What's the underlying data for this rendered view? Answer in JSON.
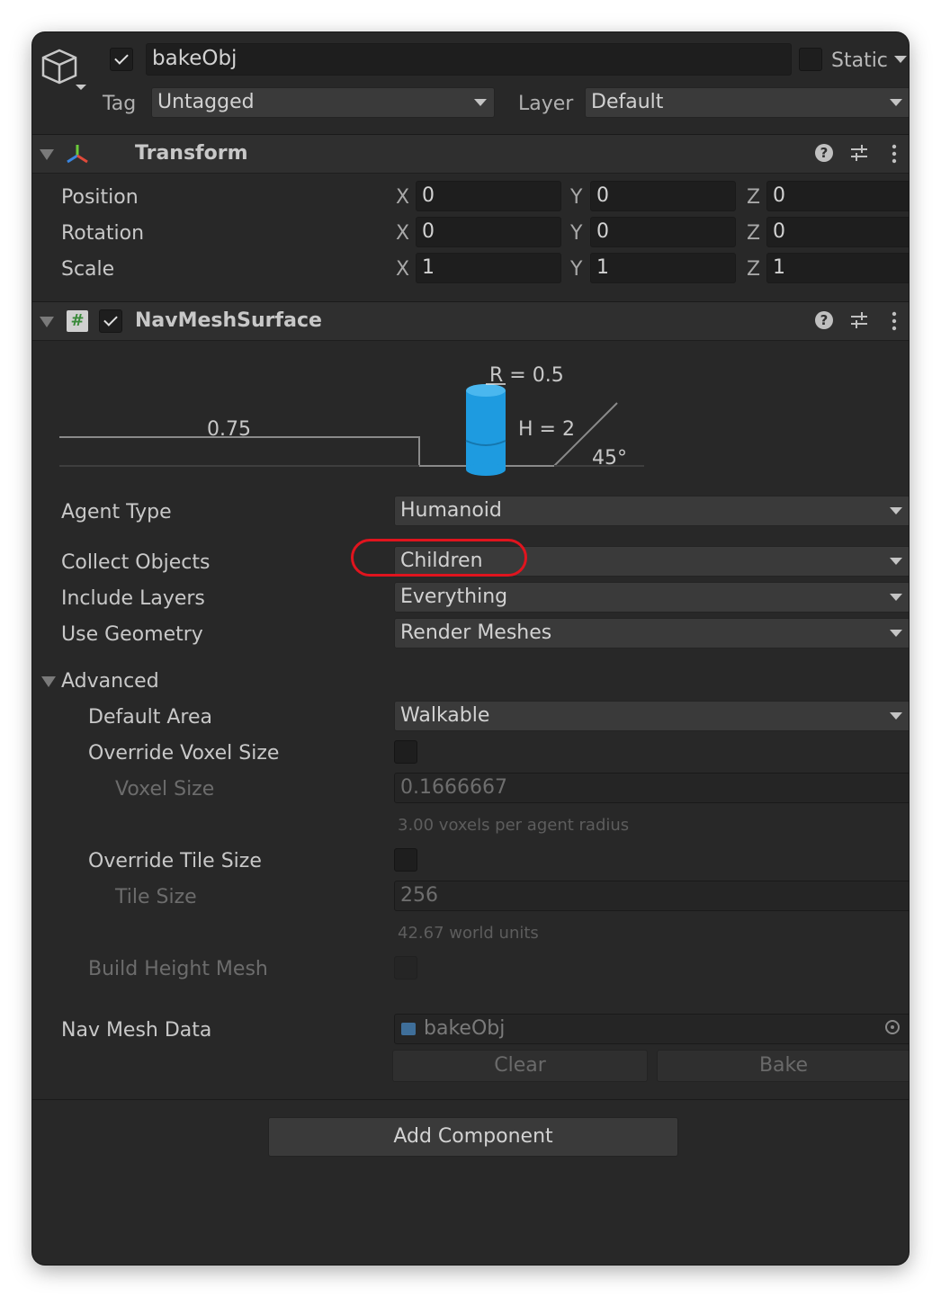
{
  "header": {
    "object_name": "bakeObj",
    "active": true,
    "static_label": "Static",
    "tag_label": "Tag",
    "tag_value": "Untagged",
    "layer_label": "Layer",
    "layer_value": "Default"
  },
  "transform": {
    "title": "Transform",
    "rows": [
      {
        "label": "Position",
        "x": "0",
        "y": "0",
        "z": "0"
      },
      {
        "label": "Rotation",
        "x": "0",
        "y": "0",
        "z": "0"
      },
      {
        "label": "Scale",
        "x": "1",
        "y": "1",
        "z": "1"
      }
    ],
    "axis_x": "X",
    "axis_y": "Y",
    "axis_z": "Z"
  },
  "navmesh": {
    "title": "NavMeshSurface",
    "enabled": true,
    "diagram": {
      "radius": "R = 0.5",
      "height": "H = 2",
      "step": "0.75",
      "slope": "45°"
    },
    "agent_type": {
      "label": "Agent Type",
      "value": "Humanoid"
    },
    "collect_objects": {
      "label": "Collect Objects",
      "value": "Children",
      "highlighted": true,
      "highlight_color": "#e0141e"
    },
    "include_layers": {
      "label": "Include Layers",
      "value": "Everything"
    },
    "use_geometry": {
      "label": "Use Geometry",
      "value": "Render Meshes"
    },
    "advanced": {
      "label": "Advanced",
      "default_area": {
        "label": "Default Area",
        "value": "Walkable"
      },
      "override_voxel": {
        "label": "Override Voxel Size",
        "checked": false
      },
      "voxel_size": {
        "label": "Voxel Size",
        "value": "0.1666667",
        "hint": "3.00 voxels per agent radius"
      },
      "override_tile": {
        "label": "Override Tile Size",
        "checked": false
      },
      "tile_size": {
        "label": "Tile Size",
        "value": "256",
        "hint": "42.67 world units"
      },
      "build_height_mesh": {
        "label": "Build Height Mesh",
        "checked": false
      }
    },
    "nav_mesh_data": {
      "label": "Nav Mesh Data",
      "value": "bakeObj"
    },
    "clear_label": "Clear",
    "bake_label": "Bake"
  },
  "add_component_label": "Add Component",
  "colors": {
    "background": "#282828",
    "cylinder": "#1e9be0",
    "highlight": "#e0141e"
  }
}
